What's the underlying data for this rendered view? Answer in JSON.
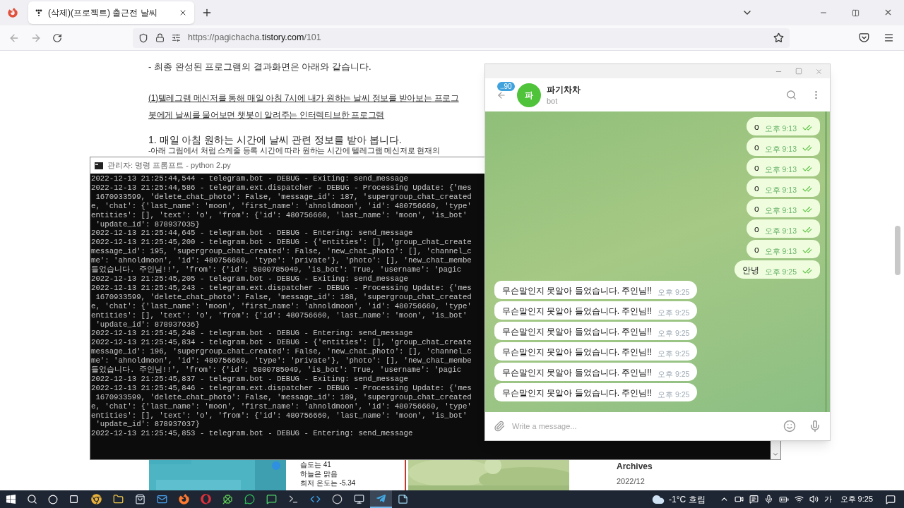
{
  "browser": {
    "tab": {
      "title": "(삭제)(프로젝트) 출근전 날씨",
      "selected": true
    },
    "url": {
      "prefix": "https://pagichacha.",
      "domain": "tistory.com",
      "path": "/101"
    }
  },
  "article": {
    "intro": "- 최종 완성된 프로그램의 결과화면은 아래와 같습니다.",
    "links": [
      "(1)텔레그램 메신저를 통해 매일 아침 7시에 내가 원하는 날씨 정보를 받아보는 프로그",
      "봇에게 날씨를 물어보면 챗봇이 알려주는 인터렉티브한 프로그램"
    ],
    "heading": "1. 매일 아침 원하는 시간에 날씨 관련 정보를 받아 봅니다.",
    "subtext": "-아래 그림에서 처럼 스케줄 등록 시간에 따라 원하는 시간에 텔레그램 메신저로 현재의"
  },
  "blog_bottom": {
    "card_lines": [
      "습도는 41",
      "하늘은 맑음",
      "최저 온도는 -5.34"
    ],
    "archives_title": "Archives",
    "archive_item": "2022/12"
  },
  "console": {
    "title": "관리자: 명령 프롬프트 - python  2.py",
    "lines": [
      "2022-12-13 21:25:44,544 - telegram.bot - DEBUG - Exiting: send_message",
      "2022-12-13 21:25:44,586 - telegram.ext.dispatcher - DEBUG - Processing Update: {'mes",
      " 1670933599, 'delete_chat_photo': False, 'message_id': 187, 'supergroup_chat_created",
      "e, 'chat': {'last_name': 'moon', 'first_name': 'ahnoldmoon', 'id': 480756660, 'type'",
      "entities': [], 'text': 'o', 'from': {'id': 480756660, 'last_name': 'moon', 'is_bot'",
      " 'update_id': 878937035}",
      "2022-12-13 21:25:44,645 - telegram.bot - DEBUG - Entering: send_message",
      "2022-12-13 21:25:45,200 - telegram.bot - DEBUG - {'entities': [], 'group_chat_create",
      "message_id': 195, 'supergroup_chat_created': False, 'new_chat_photo': [], 'channel_c",
      "me': 'ahnoldmoon', 'id': 480756660, 'type': 'private'}, 'photo': [], 'new_chat_membe",
      "들었습니다. 주인님!!', 'from': {'id': 5800785049, 'is_bot': True, 'username': 'pagic",
      "2022-12-13 21:25:45,205 - telegram.bot - DEBUG - Exiting: send_message",
      "2022-12-13 21:25:45,243 - telegram.ext.dispatcher - DEBUG - Processing Update: {'mes",
      " 1670933599, 'delete_chat_photo': False, 'message_id': 188, 'supergroup_chat_created",
      "e, 'chat': {'last_name': 'moon', 'first_name': 'ahnoldmoon', 'id': 480756660, 'type'",
      "entities': [], 'text': 'o', 'from': {'id': 480756660, 'last_name': 'moon', 'is_bot'",
      " 'update_id': 878937036}",
      "2022-12-13 21:25:45,248 - telegram.bot - DEBUG - Entering: send_message",
      "2022-12-13 21:25:45,834 - telegram.bot - DEBUG - {'entities': [], 'group_chat_create",
      "message_id': 196, 'supergroup_chat_created': False, 'new_chat_photo': [], 'channel_c",
      "me': 'ahnoldmoon', 'id': 480756660, 'type': 'private'}, 'photo': [], 'new_chat_membe",
      "들었습니다. 주인님!!', 'from': {'id': 5800785049, 'is_bot': True, 'username': 'pagic",
      "2022-12-13 21:25:45,837 - telegram.bot - DEBUG - Exiting: send_message",
      "2022-12-13 21:25:45,846 - telegram.ext.dispatcher - DEBUG - Processing Update: {'mes",
      " 1670933599, 'delete_chat_photo': False, 'message_id': 189, 'supergroup_chat_created",
      "e, 'chat': {'last_name': 'moon', 'first_name': 'ahnoldmoon', 'id': 480756660, 'type'",
      "entities': [], 'text': 'o', 'from': {'id': 480756660, 'last_name': 'moon', 'is_bot'",
      " 'update_id': 878937037}",
      "2022-12-13 21:25:45,853 - telegram.bot - DEBUG - Entering: send_message"
    ]
  },
  "telegram": {
    "unread": "..90",
    "avatar_letter": "파",
    "name": "파기차차",
    "status": "bot",
    "messages": [
      {
        "kind": "out",
        "text": "o",
        "time": "오후 9:13",
        "read": true
      },
      {
        "kind": "out",
        "text": "o",
        "time": "오후 9:13",
        "read": true
      },
      {
        "kind": "out",
        "text": "o",
        "time": "오후 9:13",
        "read": true
      },
      {
        "kind": "out",
        "text": "o",
        "time": "오후 9:13",
        "read": true
      },
      {
        "kind": "out",
        "text": "o",
        "time": "오후 9:13",
        "read": true
      },
      {
        "kind": "out",
        "text": "o",
        "time": "오후 9:13",
        "read": true
      },
      {
        "kind": "out",
        "text": "o",
        "time": "오후 9:13",
        "read": true
      },
      {
        "kind": "out",
        "text": "안녕",
        "time": "오후 9:25",
        "read": true
      },
      {
        "kind": "in",
        "text": "무슨말인지 못알아 들었습니다. 주인님!!",
        "time": "오후 9:25"
      },
      {
        "kind": "in",
        "text": "무슨말인지 못알아 들었습니다. 주인님!!",
        "time": "오후 9:25"
      },
      {
        "kind": "in",
        "text": "무슨말인지 못알아 들었습니다. 주인님!!",
        "time": "오후 9:25"
      },
      {
        "kind": "in",
        "text": "무슨말인지 못알아 들었습니다. 주인님!!",
        "time": "오후 9:25"
      },
      {
        "kind": "in",
        "text": "무슨말인지 못알아 들었습니다. 주인님!!",
        "time": "오후 9:25"
      },
      {
        "kind": "in",
        "text": "무슨말인지 못알아 들었습니다. 주인님!!",
        "time": "오후 9:25"
      }
    ],
    "input_placeholder": "Write a message..."
  },
  "taskbar": {
    "apps": [
      {
        "kind": "chrome",
        "selected": false
      },
      {
        "kind": "folder",
        "selected": false
      },
      {
        "kind": "store",
        "selected": false
      },
      {
        "kind": "mail",
        "selected": false
      },
      {
        "kind": "firefox",
        "selected": false
      },
      {
        "kind": "opera",
        "selected": false
      },
      {
        "kind": "clover",
        "selected": false
      },
      {
        "kind": "green",
        "selected": false
      },
      {
        "kind": "chat",
        "selected": false
      },
      {
        "kind": "terminal",
        "selected": false
      },
      {
        "kind": "code",
        "selected": false
      },
      {
        "kind": "obs",
        "selected": false
      },
      {
        "kind": "monitor",
        "selected": false
      },
      {
        "kind": "telegram",
        "selected": true
      },
      {
        "kind": "notes",
        "selected": false
      }
    ],
    "weather": "-1°C 흐림",
    "ime": "가",
    "clock": "오후 9:25"
  }
}
